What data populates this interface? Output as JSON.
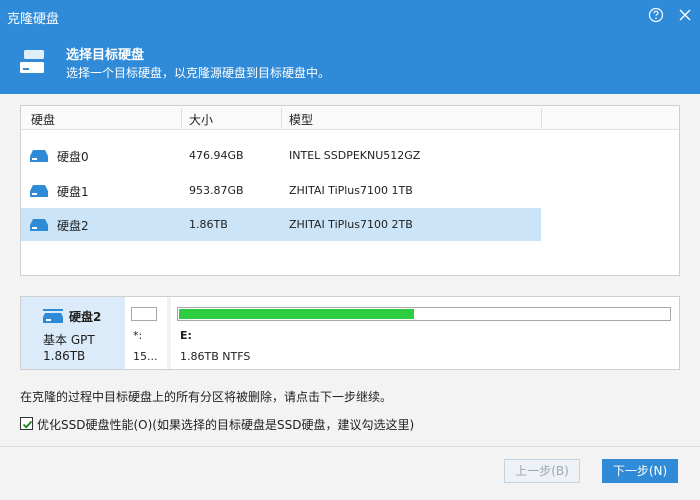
{
  "window": {
    "title": "克隆硬盘"
  },
  "header": {
    "title": "选择目标硬盘",
    "subtitle": "选择一个目标硬盘，以克隆源硬盘到目标硬盘中。"
  },
  "table": {
    "columns": [
      "硬盘",
      "大小",
      "模型"
    ],
    "rows": [
      {
        "name": "硬盘0",
        "size": "476.94GB",
        "model": "INTEL SSDPEKNU512GZ",
        "selected": false
      },
      {
        "name": "硬盘1",
        "size": "953.87GB",
        "model": "ZHITAI TiPlus7100 1TB",
        "selected": false
      },
      {
        "name": "硬盘2",
        "size": "1.86TB",
        "model": "ZHITAI TiPlus7100 2TB",
        "selected": true
      }
    ]
  },
  "disk_panel": {
    "name": "硬盘2",
    "type": "基本 GPT",
    "size": "1.86TB",
    "partitions": [
      {
        "letter": "*:",
        "size": "15...",
        "used_fraction": 0
      },
      {
        "letter": "E:",
        "info": "1.86TB NTFS",
        "used_fraction": 0.48
      }
    ]
  },
  "warning_text": "在克隆的过程中目标硬盘上的所有分区将被删除，请点击下一步继续。",
  "option": {
    "checked": true,
    "label": "优化SSD硬盘性能(O)(如果选择的目标硬盘是SSD硬盘，建议勾选这里)"
  },
  "buttons": {
    "prev": "上一步(B)",
    "next": "下一步(N)"
  },
  "colors": {
    "accent": "#2f8ad8",
    "selected_row": "#cce4f7",
    "usage_bar": "#2ecc40"
  }
}
